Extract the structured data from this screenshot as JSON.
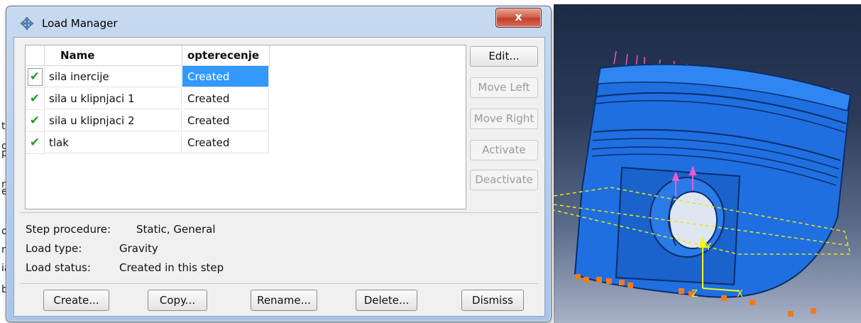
{
  "window": {
    "title": "Load Manager",
    "close_label": "x"
  },
  "table": {
    "headers": {
      "name": "Name",
      "step": "opterecenje"
    },
    "rows": [
      {
        "check": "✔",
        "name": "sila inercije",
        "status": "Created",
        "selected": true
      },
      {
        "check": "✔",
        "name": "sila u klipnjaci 1",
        "status": "Created",
        "selected": false
      },
      {
        "check": "✔",
        "name": "sila u klipnjaci 2",
        "status": "Created",
        "selected": false
      },
      {
        "check": "✔",
        "name": "tlak",
        "status": "Created",
        "selected": false
      }
    ]
  },
  "side_buttons": {
    "edit": "Edit...",
    "move_left": "Move Left",
    "move_right": "Move Right",
    "activate": "Activate",
    "deactivate": "Deactivate"
  },
  "info": {
    "step_procedure_label": "Step procedure:",
    "step_procedure_value": "Static, General",
    "load_type_label": "Load type:",
    "load_type_value": "Gravity",
    "load_status_label": "Load status:",
    "load_status_value": "Created in this step"
  },
  "bottom_buttons": {
    "create": "Create...",
    "copy": "Copy...",
    "rename": "Rename...",
    "delete": "Delete...",
    "dismiss": "Dismiss"
  },
  "background_app": {
    "glyphs": [
      "t",
      "o",
      "p",
      "re",
      "e",
      "o",
      "n",
      "ia",
      "b"
    ]
  },
  "viewport": {
    "triad_x_label": "X",
    "triad_y_label": "Y",
    "triad_z_label": "Z"
  },
  "colors": {
    "selection": "#3399ff",
    "part": "#1f6fe0",
    "load_arrows": "#e85ad8",
    "bc_markers": "#f07a1e",
    "triad": "#f5f51a"
  }
}
